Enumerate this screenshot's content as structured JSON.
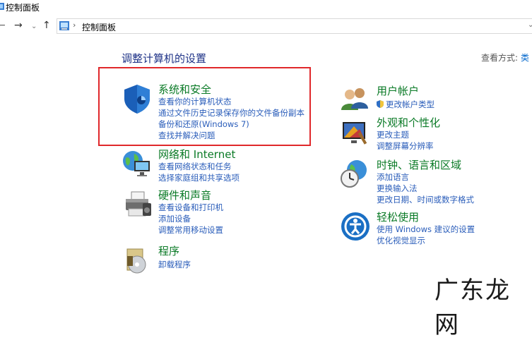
{
  "window": {
    "title": "控制面板"
  },
  "address": {
    "path": "控制面板"
  },
  "main": {
    "heading": "调整计算机的设置",
    "view_by_label": "查看方式:",
    "view_by_value": "类"
  },
  "categories": [
    {
      "title": "系统和安全",
      "icon": "shield-icon",
      "links": [
        "查看你的计算机状态",
        "通过文件历史记录保存你的文件备份副本",
        "备份和还原(Windows 7)",
        "查找并解决问题"
      ]
    },
    {
      "title": "网络和 Internet",
      "icon": "network-globe-icon",
      "links": [
        "查看网络状态和任务",
        "选择家庭组和共享选项"
      ]
    },
    {
      "title": "硬件和声音",
      "icon": "printer-icon",
      "links": [
        "查看设备和打印机",
        "添加设备",
        "调整常用移动设置"
      ]
    },
    {
      "title": "程序",
      "icon": "program-disc-icon",
      "links": [
        "卸载程序"
      ]
    },
    {
      "title": "用户帐户",
      "icon": "users-icon",
      "links": [
        "更改帐户类型"
      ]
    },
    {
      "title": "外观和个性化",
      "icon": "appearance-icon",
      "links": [
        "更改主题",
        "调整屏幕分辨率"
      ]
    },
    {
      "title": "时钟、语言和区域",
      "icon": "clock-globe-icon",
      "links": [
        "添加语言",
        "更换输入法",
        "更改日期、时间或数字格式"
      ]
    },
    {
      "title": "轻松使用",
      "icon": "ease-of-access-icon",
      "links": [
        "使用 Windows 建议的设置",
        "优化视觉显示"
      ]
    }
  ],
  "watermark": "广东龙网",
  "colors": {
    "category_title": "#0a7a26",
    "link": "#2a5dba",
    "heading": "#1e3287",
    "highlight": "#e0282b"
  }
}
